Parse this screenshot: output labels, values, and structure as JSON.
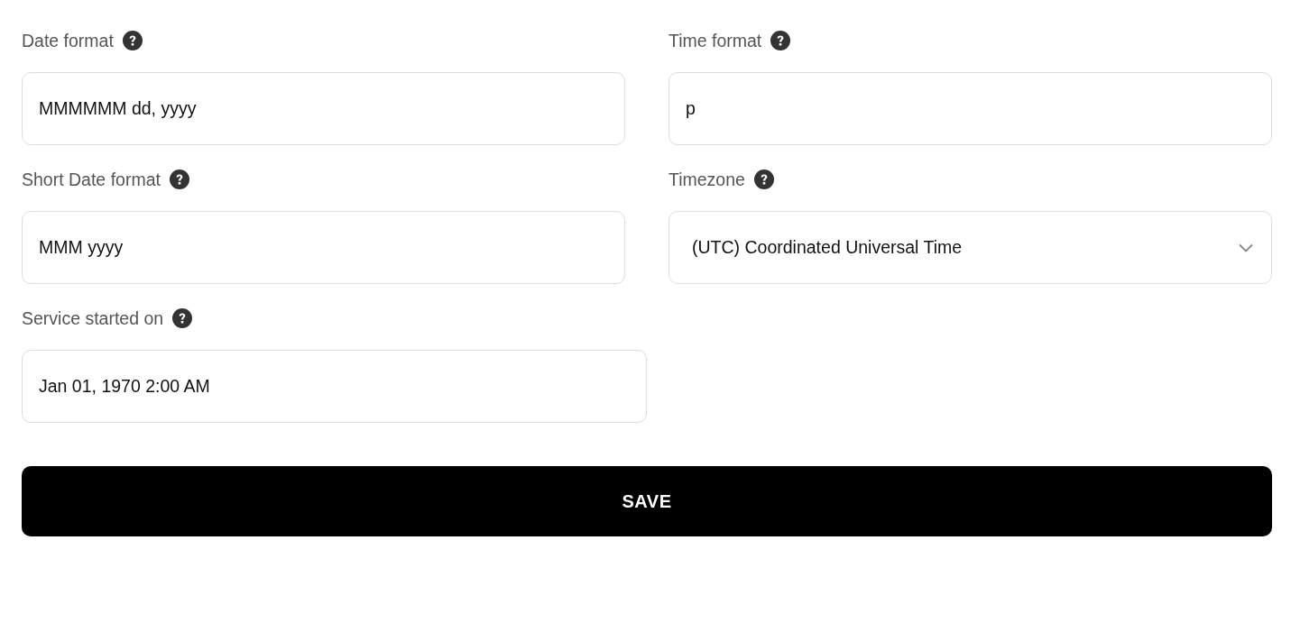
{
  "rows": [
    [
      {
        "label": "Date format",
        "kind": "text",
        "value": "MMMMMM dd, yyyy"
      },
      {
        "label": "Time format",
        "kind": "text",
        "value": "p"
      }
    ],
    [
      {
        "label": "Short Date format",
        "kind": "text",
        "value": "MMM yyyy"
      },
      {
        "label": "Timezone",
        "kind": "select",
        "value": "(UTC) Coordinated Universal Time"
      }
    ],
    [
      {
        "label": "Service started on",
        "kind": "text",
        "value": "Jan 01, 1970 2:00 AM"
      }
    ]
  ],
  "save_button": "SAVE"
}
